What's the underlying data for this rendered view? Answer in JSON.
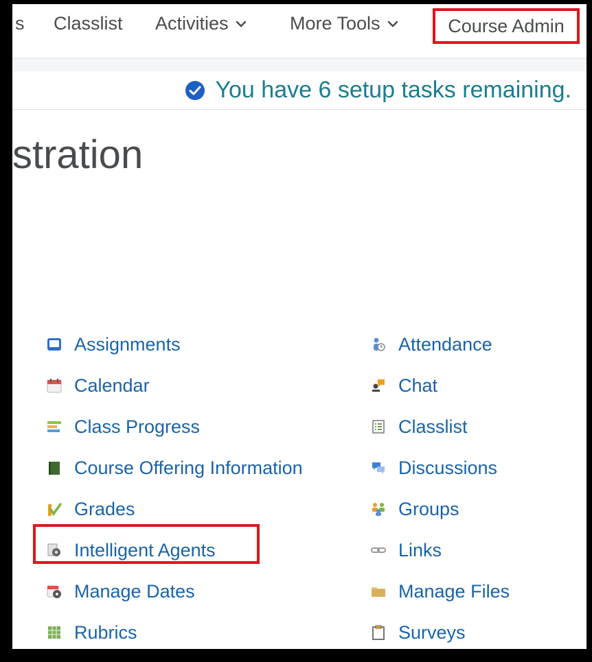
{
  "nav": {
    "partial_item": "s",
    "classlist": "Classlist",
    "activities": "Activities",
    "more_tools": "More Tools",
    "course_admin": "Course Admin"
  },
  "banner": {
    "text": "You have 6 setup tasks remaining."
  },
  "page": {
    "title_partial": "stration"
  },
  "tools": {
    "left": [
      {
        "label": "Assignments",
        "icon": "assignments-icon"
      },
      {
        "label": "Calendar",
        "icon": "calendar-icon"
      },
      {
        "label": "Class Progress",
        "icon": "class-progress-icon"
      },
      {
        "label": "Course Offering Information",
        "icon": "book-icon"
      },
      {
        "label": "Grades",
        "icon": "grades-icon"
      },
      {
        "label": "Intelligent Agents",
        "icon": "gear-document-icon"
      },
      {
        "label": "Manage Dates",
        "icon": "calendar-gear-icon"
      },
      {
        "label": "Rubrics",
        "icon": "rubrics-icon"
      }
    ],
    "right": [
      {
        "label": "Attendance",
        "icon": "attendance-icon"
      },
      {
        "label": "Chat",
        "icon": "chat-icon"
      },
      {
        "label": "Classlist",
        "icon": "classlist-icon"
      },
      {
        "label": "Discussions",
        "icon": "discussions-icon"
      },
      {
        "label": "Groups",
        "icon": "groups-icon"
      },
      {
        "label": "Links",
        "icon": "link-icon"
      },
      {
        "label": "Manage Files",
        "icon": "folder-icon"
      },
      {
        "label": "Surveys",
        "icon": "clipboard-icon"
      }
    ]
  },
  "colors": {
    "link": "#1a63a8",
    "banner_text": "#1a7d8f",
    "highlight": "#e0141e",
    "nav_text": "#494c4e"
  }
}
